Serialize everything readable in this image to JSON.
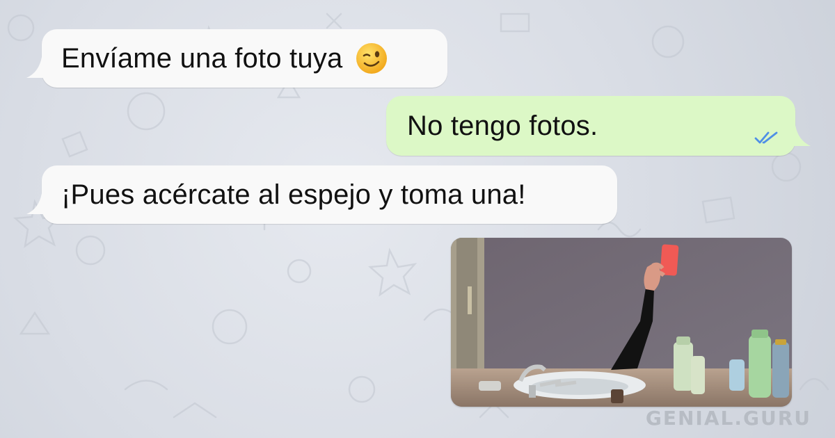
{
  "conversation": {
    "messages": [
      {
        "direction": "incoming",
        "text": "Envíame una foto tuya",
        "emoji": "winking-face-emoji"
      },
      {
        "direction": "outgoing",
        "text": "No tengo fotos.",
        "status": "read-double-check-icon"
      },
      {
        "direction": "incoming",
        "text": "¡Pues acércate al espejo y toma una!"
      },
      {
        "direction": "incoming",
        "type": "photo",
        "image": "mirror-selfie-arm-holding-phone-bathroom"
      }
    ]
  },
  "watermark": "GENIAL.GURU",
  "colors": {
    "incoming_bubble": "#f9f9f9",
    "outgoing_bubble": "#dcf8c6",
    "read_ticks": "#4f8fe6",
    "wallpaper": "#d8dde6"
  }
}
